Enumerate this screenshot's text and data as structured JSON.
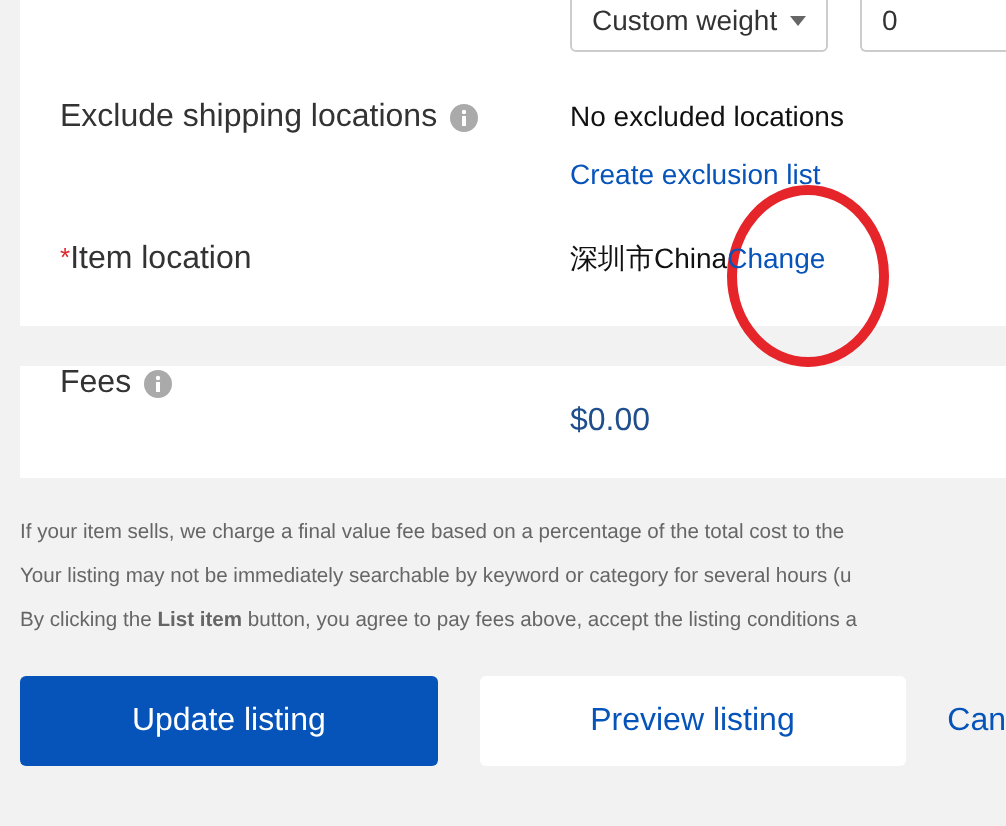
{
  "shipping_weight": {
    "unit_select": "Custom weight",
    "value": "0"
  },
  "rows": [
    {
      "label": "Exclude shipping locations",
      "info": true,
      "value": "No excluded locations",
      "link": "Create exclusion list"
    },
    {
      "label": "Item location",
      "required_mark": "*",
      "info": false,
      "value": "深圳市China",
      "link": "Change"
    }
  ],
  "fees": {
    "label": "Fees",
    "amount": "$0.00"
  },
  "notes": [
    "If your item sells, we charge a final value fee based on a percentage of the total cost to the",
    "Your listing may not be immediately searchable by keyword or category for several hours (u",
    "By clicking the **List item** button, you agree to pay fees above, accept the listing conditions a"
  ],
  "buttons": [
    {
      "label": "Update listing",
      "kind": "primary"
    },
    {
      "label": "Preview listing",
      "kind": "secondary"
    },
    {
      "label": "Can",
      "kind": "link"
    }
  ]
}
